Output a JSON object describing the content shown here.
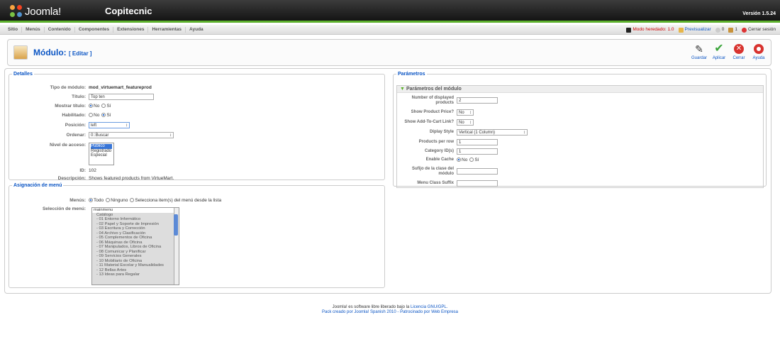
{
  "app": {
    "logo": "Joomla!",
    "site_name": "Copitecnic",
    "version": "Versión 1.5.24"
  },
  "menu": [
    "Sitio",
    "Menús",
    "Contenido",
    "Componentes",
    "Extensiones",
    "Herramientas",
    "Ayuda"
  ],
  "status": {
    "legacy": "Modo heredado: 1.0",
    "preview": "Previsualizar",
    "messages": "0",
    "users": "1",
    "logout": "Cerrar sesión"
  },
  "page": {
    "title": "Módulo:",
    "subtitle": "[ Editar ]"
  },
  "toolbar": {
    "save": "Guardar",
    "apply": "Aplicar",
    "close": "Cerrar",
    "help": "Ayuda"
  },
  "details": {
    "legend": "Detalles",
    "type_label": "Tipo de módulo:",
    "type_value": "mod_virtuemart_featureprod",
    "title_label": "Título:",
    "title_value": "Top ten",
    "show_title_label": "Mostrar título:",
    "no": "No",
    "yes": "Sí",
    "enabled_label": "Habilitado:",
    "position_label": "Posición:",
    "position_value": "left",
    "order_label": "Ordenar:",
    "order_value": "0::Buscar",
    "access_label": "Nivel de acceso:",
    "access_options": [
      "Público",
      "Registrado",
      "Especial"
    ],
    "id_label": "ID:",
    "id_value": "102",
    "desc_label": "Descripción:",
    "desc_value": "Shows featured products from VirtueMart."
  },
  "assign": {
    "legend": "Asignación de menú",
    "menus_label": "Menús:",
    "all": "Todo",
    "none": "Ninguno",
    "select": "Selecciona item(s) del menú desde la lista",
    "selection_label": "Selección de menú:",
    "items": [
      "mainmenu",
      "Catálogo",
      "- 01 Entorno Informático",
      "- 02 Papel y Soporte de Impresión",
      "- 03 Escritura y Corrección",
      "- 04 Archivo y Clasificación",
      "- 05 Complementos de Oficina",
      "- 06 Máquinas de Oficina",
      "- 07 Manipulados, Libros de Oficina",
      "- 08 Comunicar y Planificar",
      "- 09 Servicios Generales",
      "- 10 Mobiliario de Oficina",
      "- 11 Material Escolar y Manualidades",
      "- 12 Bellas Artes",
      "- 13 Ideas para Regalar"
    ]
  },
  "params": {
    "legend": "Parámetros",
    "section": "Parámetros del módulo",
    "num_label": "Number of displayed products",
    "num_value": "2",
    "price_label": "Show Product Price?",
    "price_value": "No",
    "cart_label": "Show Add-To-Cart Link?",
    "cart_value": "No",
    "style_label": "Diplay Style",
    "style_value": "Vertical (1 Column)",
    "perrow_label": "Products per row",
    "perrow_value": "1",
    "cat_label": "Category ID(s)",
    "cat_value": "1",
    "cache_label": "Enable Cache",
    "no": "No",
    "yes": "Sí",
    "suffix_label": "Sufijo de la clase del módulo",
    "suffix_value": "",
    "menusuffix_label": "Menu Class Suffix",
    "menusuffix_value": ""
  },
  "footer": {
    "line1_pre": "Joomla! es software libre liberado bajo la ",
    "line1_link": "Licencia GNU/GPL.",
    "line2": "Pack creado por Joomla! Spanish 2010 - Patrocinado por Web Empresa"
  }
}
